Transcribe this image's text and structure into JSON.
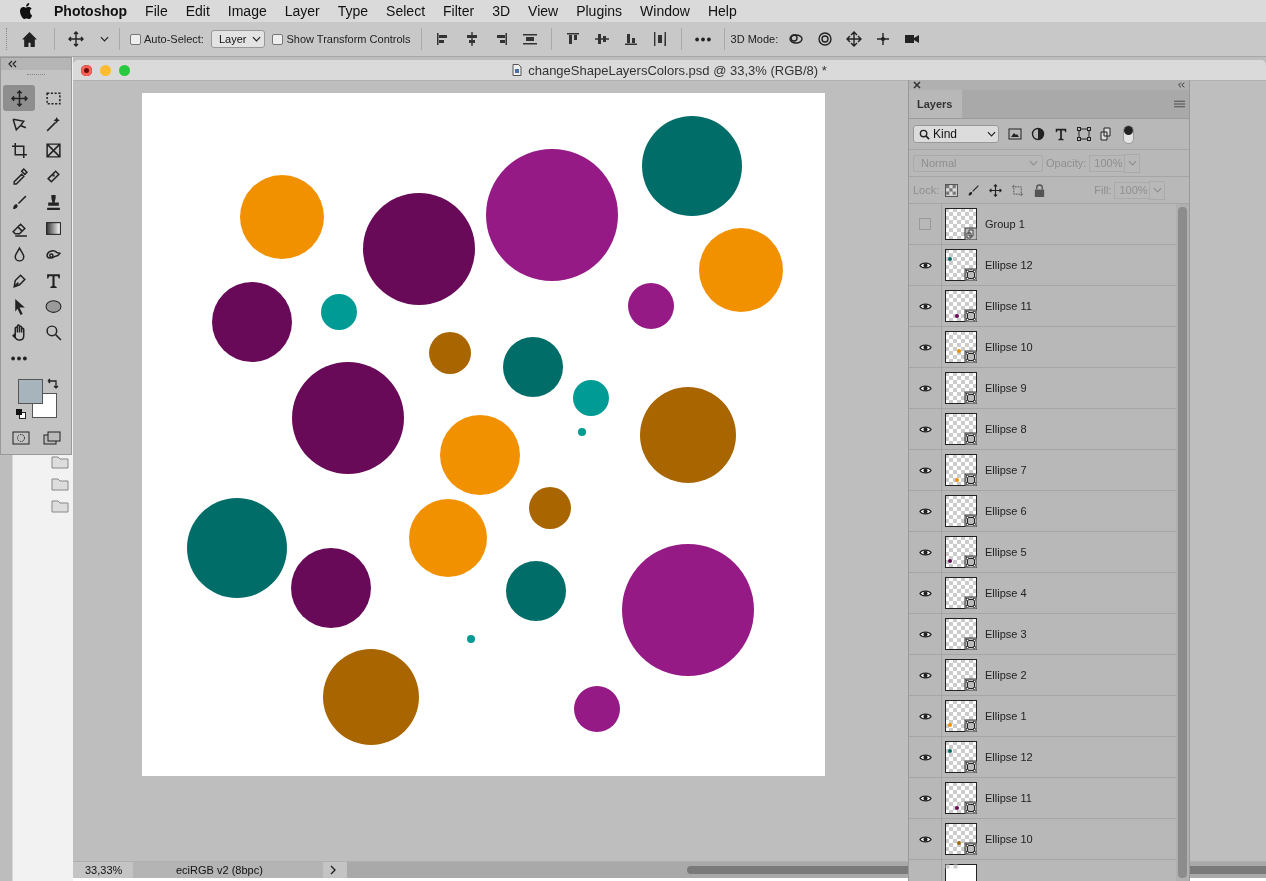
{
  "menu_bar": {
    "app_name": "Photoshop",
    "items": [
      "File",
      "Edit",
      "Image",
      "Layer",
      "Type",
      "Select",
      "Filter",
      "3D",
      "View",
      "Plugins",
      "Window",
      "Help"
    ]
  },
  "options_bar": {
    "auto_select": {
      "label": "Auto-Select:",
      "checked": false
    },
    "target": "Layer",
    "show_transform": {
      "label": "Show Transform Controls",
      "checked": false
    },
    "mode_label": "3D Mode:"
  },
  "tools": [
    {
      "selected": true
    },
    {
      "selected": false
    },
    {
      "selected": false
    },
    {
      "selected": false
    },
    {
      "selected": false
    },
    {
      "selected": false
    },
    {
      "selected": false
    },
    {
      "selected": false
    },
    {
      "selected": false
    },
    {
      "selected": false
    },
    {
      "selected": false
    },
    {
      "selected": false
    },
    {
      "selected": false
    },
    {
      "selected": false
    },
    {
      "selected": false
    },
    {
      "selected": false
    },
    {
      "selected": false
    },
    {
      "selected": false
    },
    {
      "selected": false
    },
    {
      "selected": false
    },
    {
      "selected": false
    }
  ],
  "swatches": [
    {
      "kind": "foreground",
      "color": "#a8b4bb"
    },
    {
      "kind": "background",
      "color": "#ffffff"
    }
  ],
  "document": {
    "title": "changeShapeLayersColors.psd @ 33,3% (RGB/8) *",
    "zoom": "33,33%",
    "profile": "eciRGB v2 (8bpc)"
  },
  "layers_panel": {
    "tabs": [
      {
        "label": "Layers",
        "selected": true
      }
    ],
    "filter": "Kind",
    "blend_mode": "Normal",
    "opacity_label": "Opacity:",
    "opacity": "100%",
    "lock_label": "Lock:",
    "fill_label": "Fill:",
    "fill": "100%",
    "disabled": true,
    "layers": [
      {
        "name": "Group 1",
        "kind": "group",
        "visible": false
      },
      {
        "name": "Ellipse 12",
        "kind": "shape",
        "visible": true,
        "color": "#006d68"
      },
      {
        "name": "Ellipse 11",
        "kind": "shape",
        "visible": true,
        "color": "#680a57"
      },
      {
        "name": "Ellipse 10",
        "kind": "shape",
        "visible": true,
        "color": "#f29100"
      },
      {
        "name": "Ellipse 9",
        "kind": "shape",
        "visible": true
      },
      {
        "name": "Ellipse 8",
        "kind": "shape",
        "visible": true
      },
      {
        "name": "Ellipse 7",
        "kind": "shape",
        "visible": true,
        "color": "#f29100"
      },
      {
        "name": "Ellipse 6",
        "kind": "shape",
        "visible": true
      },
      {
        "name": "Ellipse 5",
        "kind": "shape",
        "visible": true,
        "color": "#680a57"
      },
      {
        "name": "Ellipse 4",
        "kind": "shape",
        "visible": true
      },
      {
        "name": "Ellipse 3",
        "kind": "shape",
        "visible": true
      },
      {
        "name": "Ellipse 2",
        "kind": "shape",
        "visible": true
      },
      {
        "name": "Ellipse 1",
        "kind": "shape",
        "visible": true,
        "color": "#f29100"
      },
      {
        "name": "Ellipse 12",
        "kind": "shape",
        "visible": true,
        "color": "#006d68"
      },
      {
        "name": "Ellipse 11",
        "kind": "shape",
        "visible": true,
        "color": "#680a57"
      },
      {
        "name": "Ellipse 10",
        "kind": "shape",
        "visible": true,
        "color": "#a86500"
      }
    ]
  }
}
